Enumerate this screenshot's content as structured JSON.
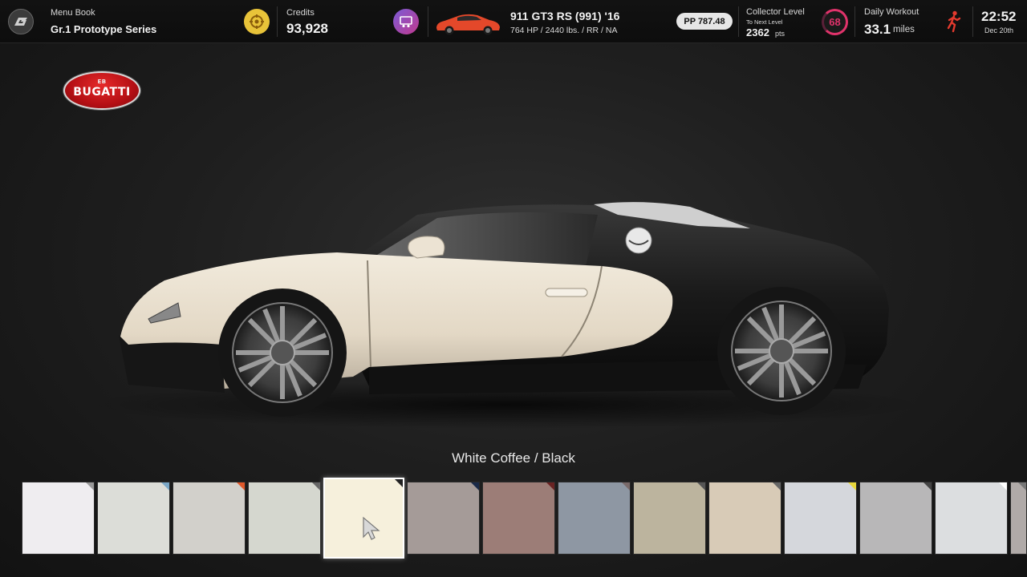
{
  "topbar": {
    "menu_label": "Menu Book",
    "menu_value": "Gr.1 Prototype Series",
    "credits_label": "Credits",
    "credits_value": "93,928",
    "car_name": "911 GT3 RS (991) '16",
    "car_specs": "764 HP / 2440 lbs. / RR / NA",
    "pp": "PP 787.48",
    "collector_label": "Collector Level",
    "collector_sub": "To Next Level",
    "collector_pts": "2362",
    "collector_pts_unit": "pts",
    "collector_level": "68",
    "workout_label": "Daily Workout",
    "workout_value": "33.1",
    "workout_unit": "miles",
    "time": "22:52",
    "date": "Dec 20th"
  },
  "brand": {
    "name": "BUGATTI",
    "emblem": "EB"
  },
  "color_name": "White Coffee / Black",
  "swatches": [
    {
      "color": "#efedf0",
      "corner": "#999999"
    },
    {
      "color": "#dcddd8",
      "corner": "#7aa7c7"
    },
    {
      "color": "#d2d0cb",
      "corner": "#e0582a"
    },
    {
      "color": "#d5d7cf",
      "corner": "#666666"
    },
    {
      "color": "#f6f0dc",
      "corner": "#222222",
      "selected": true
    },
    {
      "color": "#a59b98",
      "corner": "#1a2a48"
    },
    {
      "color": "#9c7d77",
      "corner": "#6a2323"
    },
    {
      "color": "#8e97a3",
      "corner": "#7a6a6a"
    },
    {
      "color": "#bcb49e",
      "corner": "#555555"
    },
    {
      "color": "#d8cbb7",
      "corner": "#666666"
    },
    {
      "color": "#d5d7dc",
      "corner": "#e8d73a"
    },
    {
      "color": "#b8b7b8",
      "corner": "#444444"
    },
    {
      "color": "#dcdee0",
      "corner": "#ffffff"
    },
    {
      "color": "#b0aaa8",
      "corner": "#777777"
    }
  ],
  "colors": {
    "credits_icon": "#e8c339",
    "collector_ring": "#e0336b",
    "workout_icon": "#e33a2e",
    "car_body_light": "#e9dfcd",
    "car_body_dark": "#161616"
  }
}
